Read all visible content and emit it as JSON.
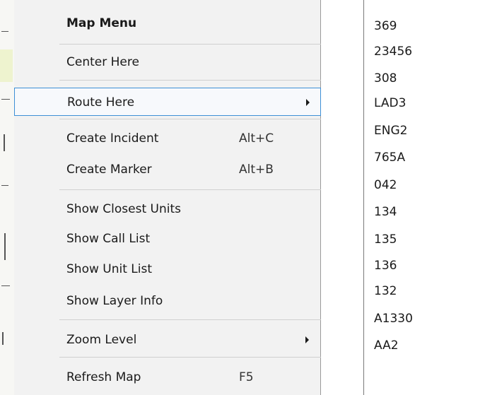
{
  "map_menu": {
    "header": "Map Menu",
    "items": [
      {
        "label": "Center Here",
        "shortcut": ""
      },
      {
        "label": "Route Here",
        "shortcut": ""
      },
      {
        "label": "Create Incident",
        "shortcut": "Alt+C"
      },
      {
        "label": "Create Marker",
        "shortcut": "Alt+B"
      },
      {
        "label": "Show Closest Units",
        "shortcut": ""
      },
      {
        "label": "Show Call List",
        "shortcut": ""
      },
      {
        "label": "Show Unit List",
        "shortcut": ""
      },
      {
        "label": "Show Layer Info",
        "shortcut": ""
      },
      {
        "label": "Zoom Level",
        "shortcut": ""
      },
      {
        "label": "Refresh Map",
        "shortcut": "F5"
      }
    ],
    "submenu_arrow_icon": "chevron-right-icon",
    "highlight_color": "#3d8fd6"
  },
  "unit_list": {
    "items": [
      "369",
      "23456",
      "308",
      "LAD3",
      "ENG2",
      "765A",
      "042",
      "134",
      "135",
      "136",
      "132",
      "A1330",
      "AA2"
    ]
  }
}
